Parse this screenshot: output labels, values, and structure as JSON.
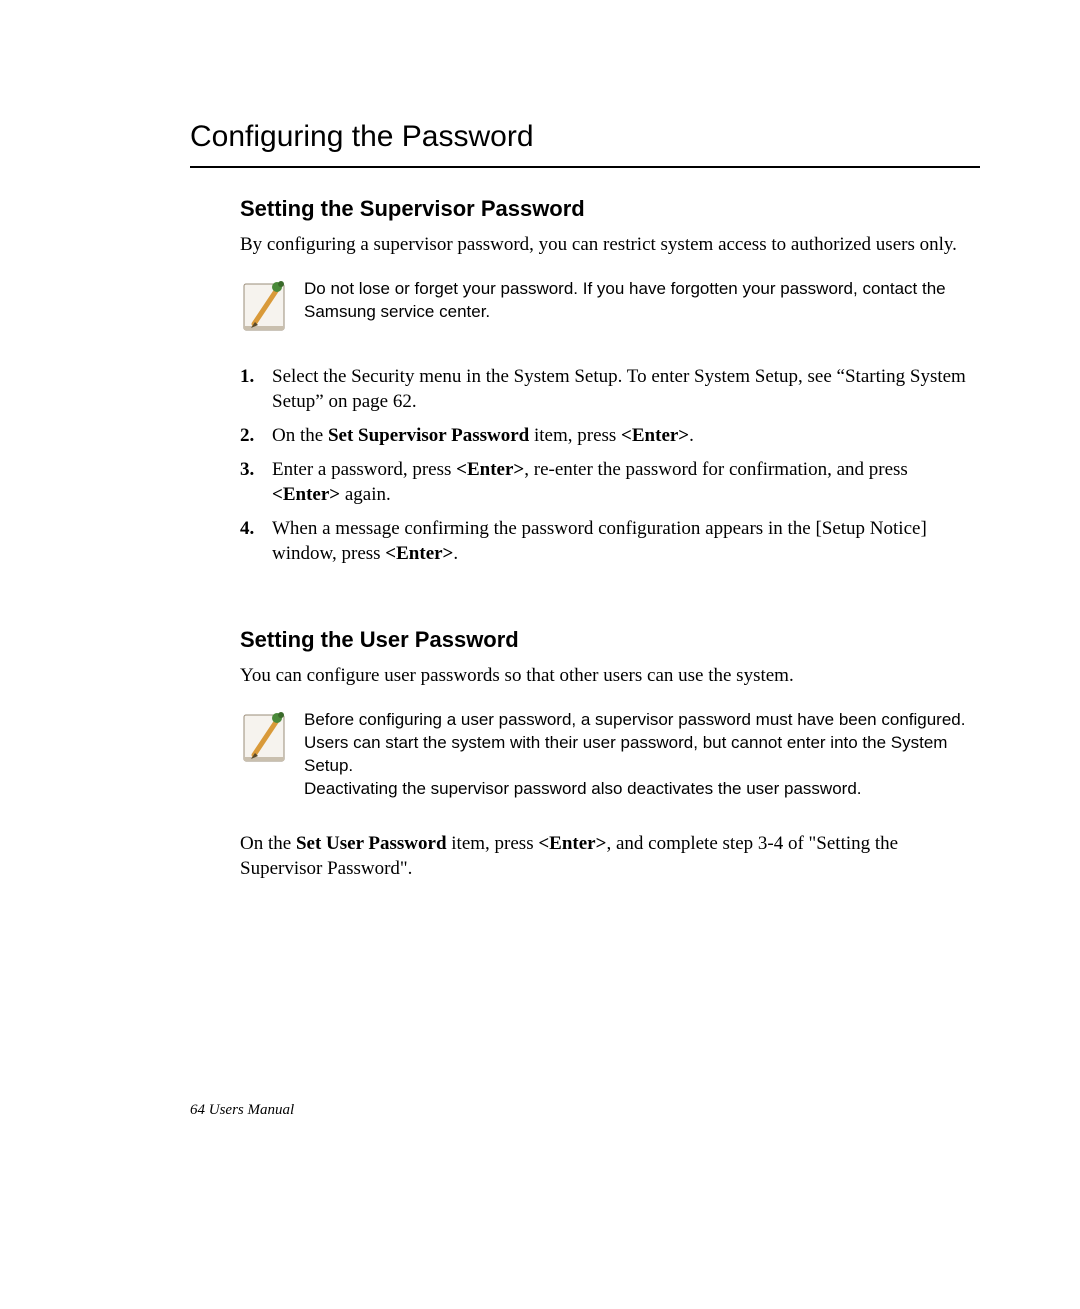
{
  "title": "Configuring the Password",
  "section1": {
    "heading": "Setting the Supervisor Password",
    "intro": "By configuring a supervisor password, you can restrict system access to authorized users only.",
    "note": "Do not lose or forget your password. If you have forgotten your password, contact the Samsung service center.",
    "steps": {
      "s1": "Select the Security menu in the System Setup. To enter System Setup, see “Starting System Setup” on page 62.",
      "s2a": "On the ",
      "s2b": "Set Supervisor Password",
      "s2c": " item, press ",
      "s2d": "<Enter>",
      "s2e": ".",
      "s3a": "Enter a password, press ",
      "s3b": "<Enter>",
      "s3c": ", re-enter the password for confirmation, and press ",
      "s3d": "<Enter>",
      "s3e": " again.",
      "s4a": "When a message confirming the password configuration appears in the [Setup Notice] window, press ",
      "s4b": "<Enter>",
      "s4c": "."
    }
  },
  "section2": {
    "heading": "Setting the User Password",
    "intro": "You can configure user passwords so that other users can use the system.",
    "note_l1": "Before configuring a user password, a supervisor password must have been configured.",
    "note_l2": "Users can start the system with their user password, but cannot enter into the System Setup.",
    "note_l3": "Deactivating the supervisor password also deactivates the user password.",
    "final_a": "On the ",
    "final_b": "Set User Password",
    "final_c": " item, press ",
    "final_d": "<Enter>",
    "final_e": ", and complete step 3-4 of \"Setting the Supervisor Password\"."
  },
  "footer": "64  Users Manual"
}
